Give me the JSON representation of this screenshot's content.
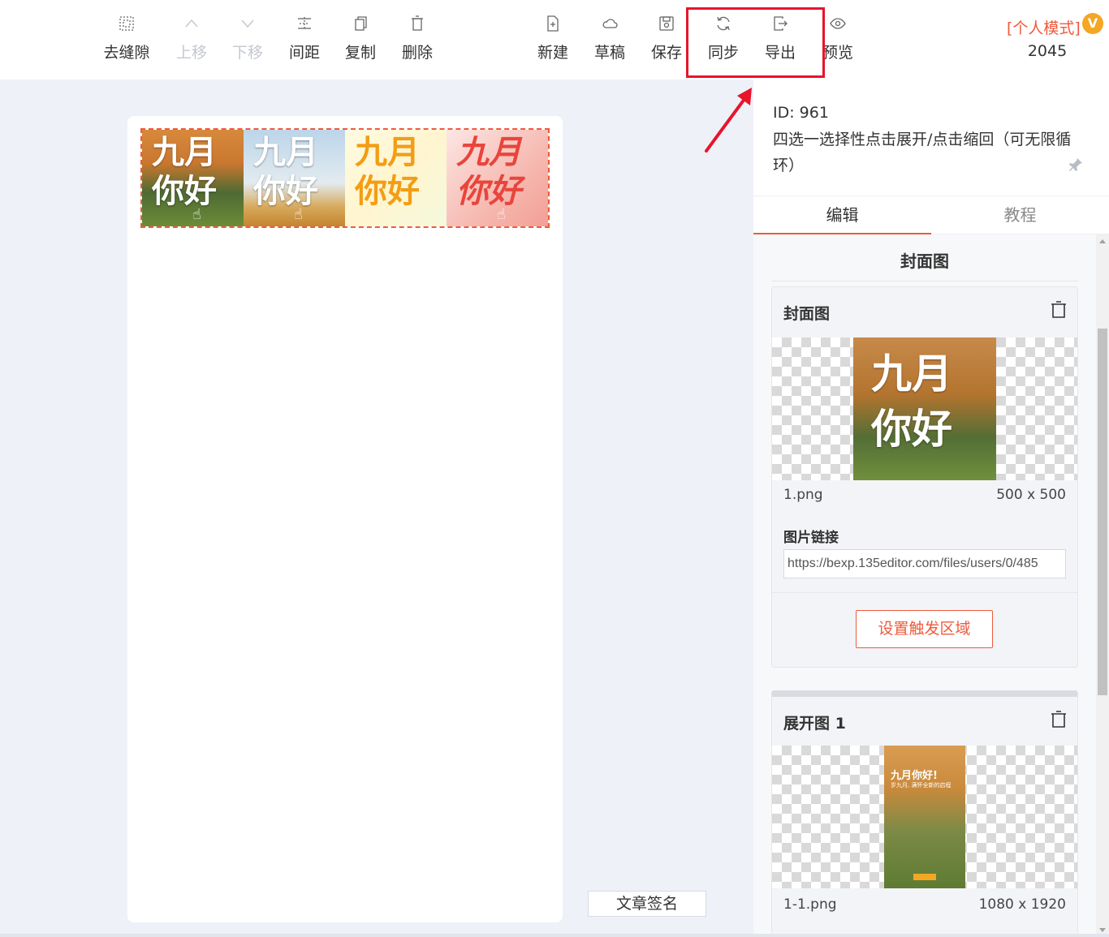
{
  "toolbar": {
    "items": [
      {
        "label": "去缝隙",
        "icon": "gap-remove-icon",
        "disabled": false
      },
      {
        "label": "上移",
        "icon": "arrow-up-icon",
        "disabled": true
      },
      {
        "label": "下移",
        "icon": "arrow-down-icon",
        "disabled": true
      },
      {
        "label": "间距",
        "icon": "spacing-icon",
        "disabled": false
      },
      {
        "label": "复制",
        "icon": "copy-icon",
        "disabled": false
      },
      {
        "label": "删除",
        "icon": "trash-icon",
        "disabled": false
      },
      {
        "label": "新建",
        "icon": "new-file-icon",
        "disabled": false
      },
      {
        "label": "草稿",
        "icon": "cloud-icon",
        "disabled": false
      },
      {
        "label": "保存",
        "icon": "save-icon",
        "disabled": false
      },
      {
        "label": "同步",
        "icon": "sync-icon",
        "disabled": false
      },
      {
        "label": "导出",
        "icon": "export-icon",
        "disabled": false
      },
      {
        "label": "预览",
        "icon": "eye-icon",
        "disabled": false
      }
    ],
    "mode_label": "[个人模式]",
    "vip_badge": "V",
    "count": "2045"
  },
  "canvas": {
    "banner_tiles": [
      {
        "line1": "九月",
        "line2": "你好"
      },
      {
        "line1": "九月",
        "line2": "你好"
      },
      {
        "line1": "九月",
        "line2": "你好"
      },
      {
        "line1": "九月",
        "line2": "你好"
      }
    ],
    "signature_button": "文章签名"
  },
  "panel": {
    "id_label": "ID: 961",
    "description": "四选一选择性点击展开/点击缩回（可无限循环）",
    "tabs": [
      "编辑",
      "教程"
    ],
    "section_title": "封面图",
    "cover_card": {
      "title": "封面图",
      "thumb_line1": "九月",
      "thumb_line2": "你好",
      "file_name": "1.png",
      "file_size": "500 x 500",
      "link_label": "图片链接",
      "link_value": "https://bexp.135editor.com/files/users/0/485",
      "trigger_button": "设置触发区域"
    },
    "expand_card": {
      "title": "展开图 1",
      "thumb_line1": "九月你好!",
      "thumb_line2": "岁九月, 满怀全新的启程",
      "file_name": "1-1.png",
      "file_size": "1080 x 1920"
    }
  },
  "colors": {
    "accent": "#ee5a3c",
    "highlight_box": "#e8142b",
    "vip_badge": "#f5a623",
    "background": "#eef1f7"
  }
}
